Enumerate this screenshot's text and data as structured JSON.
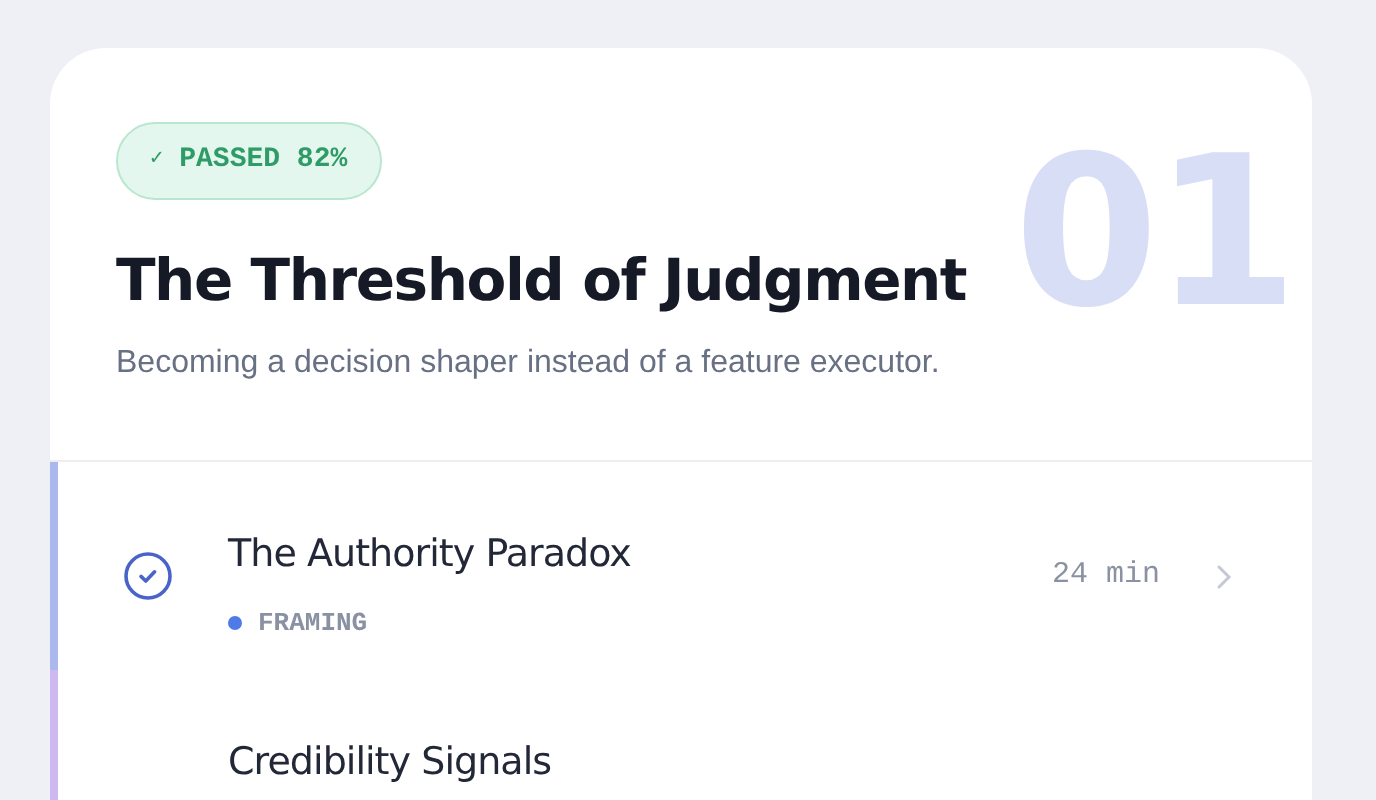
{
  "module": {
    "number": "01",
    "badge": {
      "label": "PASSED 82%",
      "icon": "✓"
    },
    "title": "The Threshold of Judgment",
    "subtitle": "Becoming a decision shaper instead of a feature executor."
  },
  "lessons": [
    {
      "title": "The Authority Paradox",
      "completed": true,
      "tag": "FRAMING",
      "color": "#4f7be8",
      "duration": "24 min"
    },
    {
      "title": "Credibility Signals"
    }
  ]
}
